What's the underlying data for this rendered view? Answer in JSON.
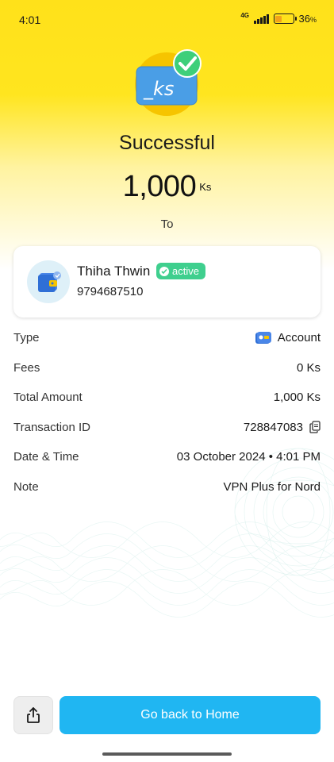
{
  "status_bar": {
    "time": "4:01",
    "network": "4G",
    "battery_percent": "36",
    "battery_percent_sign": "%",
    "battery_level": 0.36,
    "battery_color": "#f3a21a"
  },
  "hero": {
    "icon": "ks-currency-check-icon",
    "icon_text": "_ks",
    "title": "Successful",
    "amount": "1,000",
    "currency": "Ks",
    "to_label": "To"
  },
  "recipient": {
    "avatar_icon": "wallet-icon",
    "name": "Thiha Thwin",
    "status": "active",
    "status_color": "#3fcf8e",
    "phone": "9794687510"
  },
  "details": {
    "type": {
      "label": "Type",
      "value": "Account",
      "icon": "account-icon"
    },
    "fees": {
      "label": "Fees",
      "value": "0 Ks"
    },
    "total": {
      "label": "Total Amount",
      "value": "1,000 Ks"
    },
    "transaction": {
      "label": "Transaction ID",
      "value": "728847083",
      "icon": "copy-icon"
    },
    "datetime": {
      "label": "Date & Time",
      "value": "03 October 2024 • 4:01 PM"
    },
    "note": {
      "label": "Note",
      "value": "VPN Plus for Nord"
    }
  },
  "actions": {
    "share_icon": "share-icon",
    "home_label": "Go back to Home",
    "accent_color": "#20b6f2"
  },
  "theme": {
    "brand_yellow": "#ffe11a"
  }
}
